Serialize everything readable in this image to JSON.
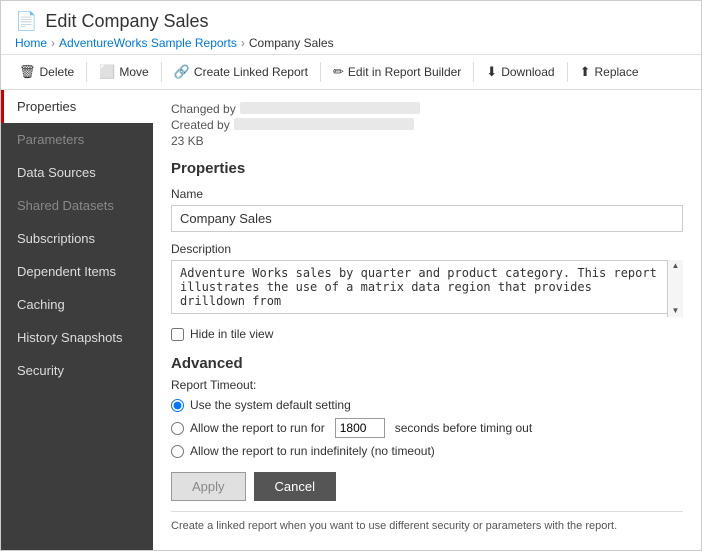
{
  "header": {
    "icon": "📄",
    "title": "Edit Company Sales",
    "breadcrumb": {
      "home": "Home",
      "section": "AdventureWorks Sample Reports",
      "current": "Company Sales"
    }
  },
  "toolbar": {
    "buttons": [
      {
        "id": "delete",
        "icon": "🗑",
        "label": "Delete"
      },
      {
        "id": "move",
        "icon": "⬜",
        "label": "Move"
      },
      {
        "id": "create-linked",
        "icon": "🔗",
        "label": "Create Linked Report"
      },
      {
        "id": "edit-builder",
        "icon": "✏",
        "label": "Edit in Report Builder"
      },
      {
        "id": "download",
        "icon": "⬇",
        "label": "Download"
      },
      {
        "id": "replace",
        "icon": "⬆",
        "label": "Replace"
      }
    ]
  },
  "sidebar": {
    "items": [
      {
        "id": "properties",
        "label": "Properties",
        "active": true
      },
      {
        "id": "parameters",
        "label": "Parameters",
        "disabled": true
      },
      {
        "id": "data-sources",
        "label": "Data Sources"
      },
      {
        "id": "shared-datasets",
        "label": "Shared Datasets",
        "disabled": true
      },
      {
        "id": "subscriptions",
        "label": "Subscriptions"
      },
      {
        "id": "dependent-items",
        "label": "Dependent Items"
      },
      {
        "id": "caching",
        "label": "Caching"
      },
      {
        "id": "history-snapshots",
        "label": "History Snapshots"
      },
      {
        "id": "security",
        "label": "Security"
      }
    ]
  },
  "content": {
    "meta": {
      "changed_by_label": "Changed by",
      "created_by_label": "Created by",
      "size": "23 KB"
    },
    "properties_section": "Properties",
    "name_label": "Name",
    "name_value": "Company Sales",
    "description_label": "Description",
    "description_value": "Adventure Works sales by quarter and product category. This report illustrates the use of a matrix data region that provides drilldown from",
    "hide_tile_label": "Hide in tile view",
    "advanced_section": "Advanced",
    "timeout_label": "Report Timeout:",
    "radio_system": "Use the system default setting",
    "radio_custom": "Allow the report to run for",
    "timeout_value": "1800",
    "timeout_suffix": "seconds before timing out",
    "radio_indefinite": "Allow the report to run indefinitely (no timeout)",
    "apply_label": "Apply",
    "cancel_label": "Cancel",
    "footer_note": "Create a linked report when you want to use different security or parameters with the report."
  }
}
